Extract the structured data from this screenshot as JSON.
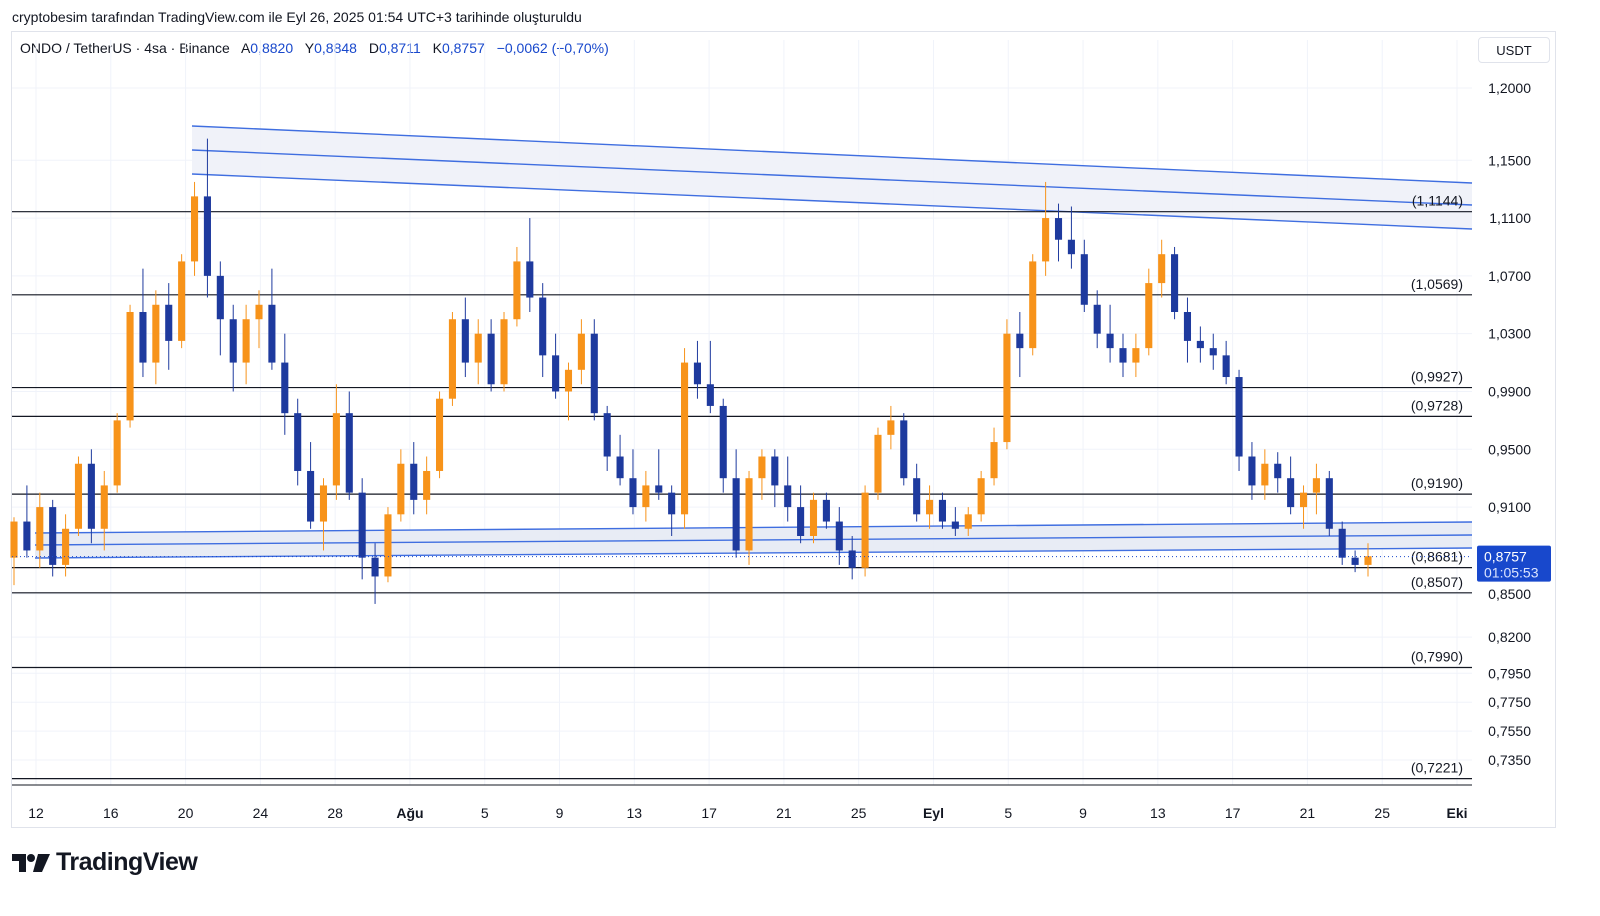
{
  "caption": "cryptobesim tarafından TradingView.com ile Eyl 26, 2025 01:54 UTC+3 tarihinde oluşturuldu",
  "header": {
    "symbol": "ONDO / TetherUS · 4sa · Binance",
    "open_label": "A",
    "open": "0,8820",
    "high_label": "Y",
    "high": "0,8848",
    "low_label": "D",
    "low": "0,8711",
    "close_label": "K",
    "close": "0,8757",
    "change": "−0,0062 (−0,70%)"
  },
  "unit": "USDT",
  "price_tag": {
    "value": "0,8757",
    "countdown": "01:05:53"
  },
  "logo": {
    "text": "TradingView"
  },
  "colors": {
    "up": "#f7931a",
    "down": "#1e3a9e",
    "trendline": "#3f6ee0",
    "level": "#131722",
    "tag": "#1848cc"
  },
  "chart_data": {
    "type": "candlestick",
    "y_axis_ticks": [
      "1,2000",
      "1,1500",
      "1,1100",
      "1,0700",
      "1,0300",
      "0,9900",
      "0,9500",
      "0,9100",
      "0,8500",
      "0,8200",
      "0,7950",
      "0,7750",
      "0,7550",
      "0,7350"
    ],
    "x_axis_ticks": [
      "12",
      "16",
      "20",
      "24",
      "28",
      "Ağu",
      "5",
      "9",
      "13",
      "17",
      "21",
      "25",
      "Eyl",
      "5",
      "9",
      "13",
      "17",
      "21",
      "25",
      "Eki"
    ],
    "levels": [
      {
        "label": "(1,1144)",
        "value": 1.1144
      },
      {
        "label": "(1,0569)",
        "value": 1.0569
      },
      {
        "label": "(0,9927)",
        "value": 0.9927
      },
      {
        "label": "(0,9728)",
        "value": 0.9728
      },
      {
        "label": "(0,9190)",
        "value": 0.919
      },
      {
        "label": "(0,8681)",
        "value": 0.8681
      },
      {
        "label": "(0,8507)",
        "value": 0.8507
      },
      {
        "label": "(0,7990)",
        "value": 0.799
      },
      {
        "label": "(0,7221)",
        "value": 0.7221
      }
    ],
    "current_price": 0.8757,
    "ohlc": [
      {
        "o": 0.875,
        "h": 0.903,
        "l": 0.856,
        "c": 0.9
      },
      {
        "o": 0.9,
        "h": 0.925,
        "l": 0.875,
        "c": 0.88
      },
      {
        "o": 0.88,
        "h": 0.92,
        "l": 0.868,
        "c": 0.91
      },
      {
        "o": 0.91,
        "h": 0.915,
        "l": 0.862,
        "c": 0.87
      },
      {
        "o": 0.87,
        "h": 0.905,
        "l": 0.862,
        "c": 0.895
      },
      {
        "o": 0.895,
        "h": 0.945,
        "l": 0.89,
        "c": 0.94
      },
      {
        "o": 0.94,
        "h": 0.95,
        "l": 0.885,
        "c": 0.895
      },
      {
        "o": 0.895,
        "h": 0.935,
        "l": 0.88,
        "c": 0.925
      },
      {
        "o": 0.925,
        "h": 0.975,
        "l": 0.92,
        "c": 0.97
      },
      {
        "o": 0.97,
        "h": 1.05,
        "l": 0.965,
        "c": 1.045
      },
      {
        "o": 1.045,
        "h": 1.075,
        "l": 1.0,
        "c": 1.01
      },
      {
        "o": 1.01,
        "h": 1.06,
        "l": 0.995,
        "c": 1.05
      },
      {
        "o": 1.05,
        "h": 1.065,
        "l": 1.005,
        "c": 1.025
      },
      {
        "o": 1.025,
        "h": 1.085,
        "l": 1.02,
        "c": 1.08
      },
      {
        "o": 1.08,
        "h": 1.135,
        "l": 1.07,
        "c": 1.125
      },
      {
        "o": 1.125,
        "h": 1.165,
        "l": 1.055,
        "c": 1.07
      },
      {
        "o": 1.07,
        "h": 1.08,
        "l": 1.015,
        "c": 1.04
      },
      {
        "o": 1.04,
        "h": 1.05,
        "l": 0.99,
        "c": 1.01
      },
      {
        "o": 1.01,
        "h": 1.05,
        "l": 0.995,
        "c": 1.04
      },
      {
        "o": 1.04,
        "h": 1.06,
        "l": 1.02,
        "c": 1.05
      },
      {
        "o": 1.05,
        "h": 1.075,
        "l": 1.005,
        "c": 1.01
      },
      {
        "o": 1.01,
        "h": 1.03,
        "l": 0.96,
        "c": 0.975
      },
      {
        "o": 0.975,
        "h": 0.985,
        "l": 0.925,
        "c": 0.935
      },
      {
        "o": 0.935,
        "h": 0.955,
        "l": 0.895,
        "c": 0.9
      },
      {
        "o": 0.9,
        "h": 0.93,
        "l": 0.88,
        "c": 0.925
      },
      {
        "o": 0.925,
        "h": 0.995,
        "l": 0.915,
        "c": 0.975
      },
      {
        "o": 0.975,
        "h": 0.99,
        "l": 0.915,
        "c": 0.92
      },
      {
        "o": 0.92,
        "h": 0.93,
        "l": 0.86,
        "c": 0.875
      },
      {
        "o": 0.875,
        "h": 0.885,
        "l": 0.843,
        "c": 0.862
      },
      {
        "o": 0.862,
        "h": 0.91,
        "l": 0.858,
        "c": 0.905
      },
      {
        "o": 0.905,
        "h": 0.95,
        "l": 0.9,
        "c": 0.94
      },
      {
        "o": 0.94,
        "h": 0.955,
        "l": 0.905,
        "c": 0.915
      },
      {
        "o": 0.915,
        "h": 0.945,
        "l": 0.905,
        "c": 0.935
      },
      {
        "o": 0.935,
        "h": 0.99,
        "l": 0.93,
        "c": 0.985
      },
      {
        "o": 0.985,
        "h": 1.045,
        "l": 0.98,
        "c": 1.04
      },
      {
        "o": 1.04,
        "h": 1.055,
        "l": 1.0,
        "c": 1.01
      },
      {
        "o": 1.01,
        "h": 1.04,
        "l": 0.995,
        "c": 1.03
      },
      {
        "o": 1.03,
        "h": 1.04,
        "l": 0.99,
        "c": 0.995
      },
      {
        "o": 0.995,
        "h": 1.045,
        "l": 0.99,
        "c": 1.04
      },
      {
        "o": 1.04,
        "h": 1.09,
        "l": 1.035,
        "c": 1.08
      },
      {
        "o": 1.08,
        "h": 1.11,
        "l": 1.045,
        "c": 1.055
      },
      {
        "o": 1.055,
        "h": 1.065,
        "l": 1.0,
        "c": 1.015
      },
      {
        "o": 1.015,
        "h": 1.03,
        "l": 0.985,
        "c": 0.99
      },
      {
        "o": 0.99,
        "h": 1.01,
        "l": 0.97,
        "c": 1.005
      },
      {
        "o": 1.005,
        "h": 1.04,
        "l": 0.995,
        "c": 1.03
      },
      {
        "o": 1.03,
        "h": 1.04,
        "l": 0.97,
        "c": 0.975
      },
      {
        "o": 0.975,
        "h": 0.98,
        "l": 0.935,
        "c": 0.945
      },
      {
        "o": 0.945,
        "h": 0.96,
        "l": 0.925,
        "c": 0.93
      },
      {
        "o": 0.93,
        "h": 0.95,
        "l": 0.905,
        "c": 0.91
      },
      {
        "o": 0.91,
        "h": 0.935,
        "l": 0.9,
        "c": 0.925
      },
      {
        "o": 0.925,
        "h": 0.95,
        "l": 0.915,
        "c": 0.92
      },
      {
        "o": 0.92,
        "h": 0.925,
        "l": 0.89,
        "c": 0.905
      },
      {
        "o": 0.905,
        "h": 1.02,
        "l": 0.895,
        "c": 1.01
      },
      {
        "o": 1.01,
        "h": 1.025,
        "l": 0.985,
        "c": 0.995
      },
      {
        "o": 0.995,
        "h": 1.025,
        "l": 0.975,
        "c": 0.98
      },
      {
        "o": 0.98,
        "h": 0.985,
        "l": 0.92,
        "c": 0.93
      },
      {
        "o": 0.93,
        "h": 0.95,
        "l": 0.875,
        "c": 0.88
      },
      {
        "o": 0.88,
        "h": 0.935,
        "l": 0.87,
        "c": 0.93
      },
      {
        "o": 0.93,
        "h": 0.95,
        "l": 0.915,
        "c": 0.945
      },
      {
        "o": 0.945,
        "h": 0.95,
        "l": 0.91,
        "c": 0.925
      },
      {
        "o": 0.925,
        "h": 0.945,
        "l": 0.9,
        "c": 0.91
      },
      {
        "o": 0.91,
        "h": 0.925,
        "l": 0.885,
        "c": 0.89
      },
      {
        "o": 0.89,
        "h": 0.92,
        "l": 0.885,
        "c": 0.915
      },
      {
        "o": 0.915,
        "h": 0.92,
        "l": 0.895,
        "c": 0.9
      },
      {
        "o": 0.9,
        "h": 0.91,
        "l": 0.87,
        "c": 0.88
      },
      {
        "o": 0.88,
        "h": 0.89,
        "l": 0.86,
        "c": 0.868
      },
      {
        "o": 0.868,
        "h": 0.925,
        "l": 0.862,
        "c": 0.92
      },
      {
        "o": 0.92,
        "h": 0.965,
        "l": 0.915,
        "c": 0.96
      },
      {
        "o": 0.96,
        "h": 0.98,
        "l": 0.95,
        "c": 0.97
      },
      {
        "o": 0.97,
        "h": 0.975,
        "l": 0.925,
        "c": 0.93
      },
      {
        "o": 0.93,
        "h": 0.94,
        "l": 0.9,
        "c": 0.905
      },
      {
        "o": 0.905,
        "h": 0.925,
        "l": 0.895,
        "c": 0.915
      },
      {
        "o": 0.915,
        "h": 0.92,
        "l": 0.895,
        "c": 0.9
      },
      {
        "o": 0.9,
        "h": 0.91,
        "l": 0.89,
        "c": 0.895
      },
      {
        "o": 0.895,
        "h": 0.91,
        "l": 0.89,
        "c": 0.905
      },
      {
        "o": 0.905,
        "h": 0.935,
        "l": 0.9,
        "c": 0.93
      },
      {
        "o": 0.93,
        "h": 0.965,
        "l": 0.925,
        "c": 0.955
      },
      {
        "o": 0.955,
        "h": 1.04,
        "l": 0.95,
        "c": 1.03
      },
      {
        "o": 1.03,
        "h": 1.045,
        "l": 1.0,
        "c": 1.02
      },
      {
        "o": 1.02,
        "h": 1.085,
        "l": 1.015,
        "c": 1.08
      },
      {
        "o": 1.08,
        "h": 1.135,
        "l": 1.07,
        "c": 1.11
      },
      {
        "o": 1.11,
        "h": 1.12,
        "l": 1.08,
        "c": 1.095
      },
      {
        "o": 1.095,
        "h": 1.118,
        "l": 1.075,
        "c": 1.085
      },
      {
        "o": 1.085,
        "h": 1.095,
        "l": 1.045,
        "c": 1.05
      },
      {
        "o": 1.05,
        "h": 1.06,
        "l": 1.02,
        "c": 1.03
      },
      {
        "o": 1.03,
        "h": 1.05,
        "l": 1.01,
        "c": 1.02
      },
      {
        "o": 1.02,
        "h": 1.03,
        "l": 1.0,
        "c": 1.01
      },
      {
        "o": 1.01,
        "h": 1.03,
        "l": 1.0,
        "c": 1.02
      },
      {
        "o": 1.02,
        "h": 1.075,
        "l": 1.015,
        "c": 1.065
      },
      {
        "o": 1.065,
        "h": 1.095,
        "l": 1.055,
        "c": 1.085
      },
      {
        "o": 1.085,
        "h": 1.09,
        "l": 1.04,
        "c": 1.045
      },
      {
        "o": 1.045,
        "h": 1.055,
        "l": 1.01,
        "c": 1.025
      },
      {
        "o": 1.025,
        "h": 1.035,
        "l": 1.01,
        "c": 1.02
      },
      {
        "o": 1.02,
        "h": 1.03,
        "l": 1.005,
        "c": 1.015
      },
      {
        "o": 1.015,
        "h": 1.025,
        "l": 0.995,
        "c": 1.0
      },
      {
        "o": 1.0,
        "h": 1.005,
        "l": 0.935,
        "c": 0.945
      },
      {
        "o": 0.945,
        "h": 0.955,
        "l": 0.915,
        "c": 0.925
      },
      {
        "o": 0.925,
        "h": 0.95,
        "l": 0.915,
        "c": 0.94
      },
      {
        "o": 0.94,
        "h": 0.948,
        "l": 0.92,
        "c": 0.93
      },
      {
        "o": 0.93,
        "h": 0.945,
        "l": 0.905,
        "c": 0.91
      },
      {
        "o": 0.91,
        "h": 0.925,
        "l": 0.895,
        "c": 0.92
      },
      {
        "o": 0.92,
        "h": 0.94,
        "l": 0.905,
        "c": 0.93
      },
      {
        "o": 0.93,
        "h": 0.935,
        "l": 0.89,
        "c": 0.895
      },
      {
        "o": 0.895,
        "h": 0.9,
        "l": 0.87,
        "c": 0.875
      },
      {
        "o": 0.875,
        "h": 0.88,
        "l": 0.865,
        "c": 0.87
      },
      {
        "o": 0.87,
        "h": 0.885,
        "l": 0.862,
        "c": 0.876
      }
    ]
  }
}
